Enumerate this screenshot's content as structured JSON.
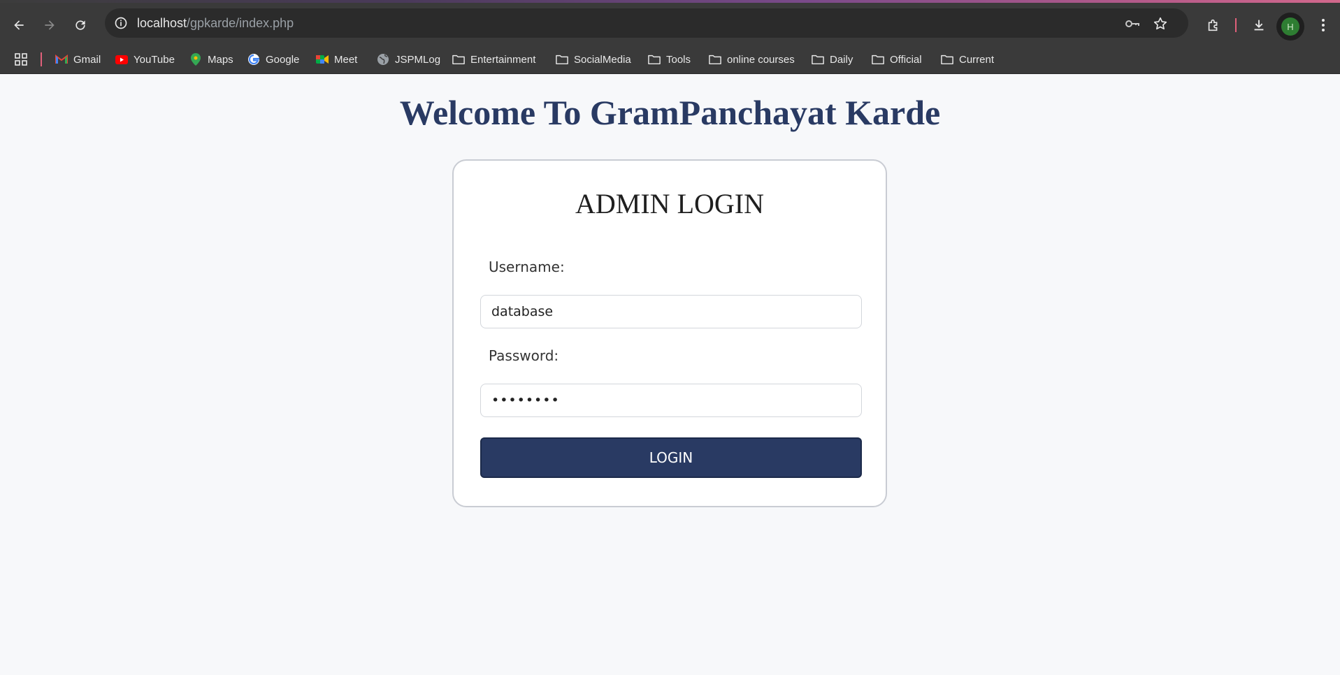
{
  "browser": {
    "url_host": "localhost",
    "url_path": "/gpkarde/index.php",
    "avatar_initial": "H",
    "bookmarks": [
      {
        "label": "Gmail",
        "icon": "gmail-icon"
      },
      {
        "label": "YouTube",
        "icon": "youtube-icon"
      },
      {
        "label": "Maps",
        "icon": "maps-icon"
      },
      {
        "label": "Google",
        "icon": "google-icon"
      },
      {
        "label": "Meet",
        "icon": "meet-icon"
      },
      {
        "label": "JSPMLog",
        "icon": "globe-icon"
      },
      {
        "label": "Entertainment",
        "icon": "folder-icon"
      },
      {
        "label": "SocialMedia",
        "icon": "folder-icon"
      },
      {
        "label": "Tools",
        "icon": "folder-icon"
      },
      {
        "label": "online courses",
        "icon": "folder-icon"
      },
      {
        "label": "Daily",
        "icon": "folder-icon"
      },
      {
        "label": "Official",
        "icon": "folder-icon"
      },
      {
        "label": "Current",
        "icon": "folder-icon"
      }
    ]
  },
  "page": {
    "welcome": "Welcome To GramPanchayat Karde",
    "login": {
      "title": "ADMIN LOGIN",
      "username_label": "Username:",
      "username_value": "database",
      "password_label": "Password:",
      "password_value": "••••••••",
      "button_label": "LOGIN"
    }
  },
  "colors": {
    "accent": "#293a63",
    "page_bg": "#f7f8fa",
    "browser_bar": "#3a3a3a"
  }
}
